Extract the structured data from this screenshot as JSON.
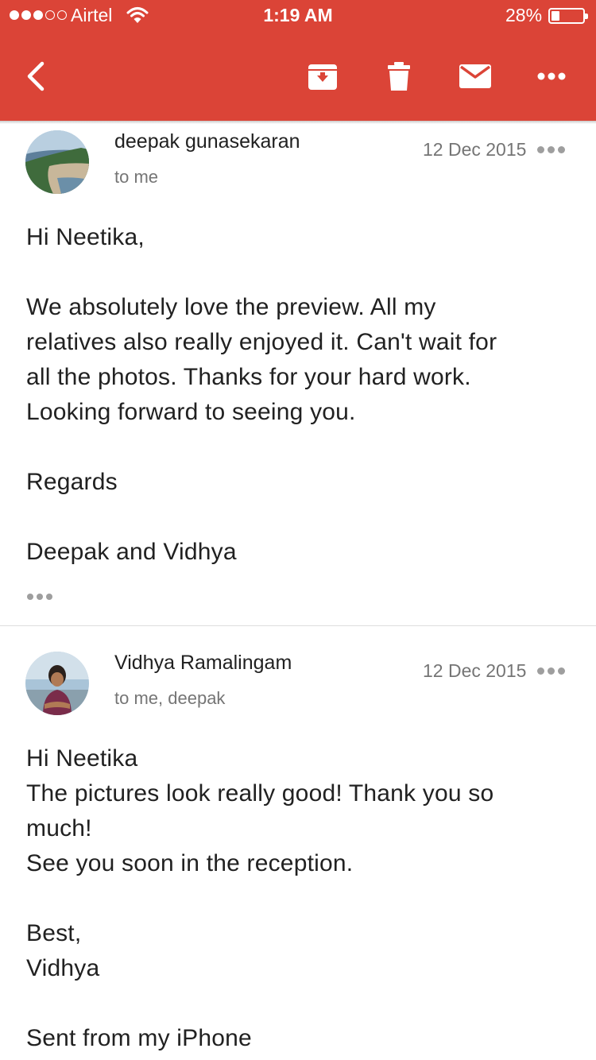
{
  "status_bar": {
    "carrier": "Airtel",
    "time": "1:19 AM",
    "battery": "28%",
    "battery_level": 0.28,
    "signal_bars_filled": 3,
    "signal_bars_total": 5
  },
  "toolbar": {
    "icons": [
      "back-icon",
      "archive-icon",
      "trash-icon",
      "mail-icon",
      "more-icon"
    ]
  },
  "colors": {
    "accent": "#db4437",
    "text": "#212121",
    "secondary_text": "#757575"
  },
  "messages": [
    {
      "sender": "deepak gunasekaran",
      "recipients": "to me",
      "date": "12 Dec 2015",
      "body": [
        "Hi Neetika,",
        "We absolutely love the preview. All my",
        "relatives also really enjoyed it. Can't wait for",
        "all the photos. Thanks for your hard work.",
        "Looking forward to seeing you.",
        "Regards",
        "Deepak and Vidhya"
      ]
    },
    {
      "sender": "Vidhya Ramalingam",
      "recipients": "to me, deepak",
      "date": "12 Dec 2015",
      "body": [
        "Hi Neetika",
        "The pictures look really good! Thank you so",
        "much!",
        "See you soon in the reception.",
        "Best,",
        "Vidhya",
        "Sent from my iPhone"
      ]
    }
  ]
}
